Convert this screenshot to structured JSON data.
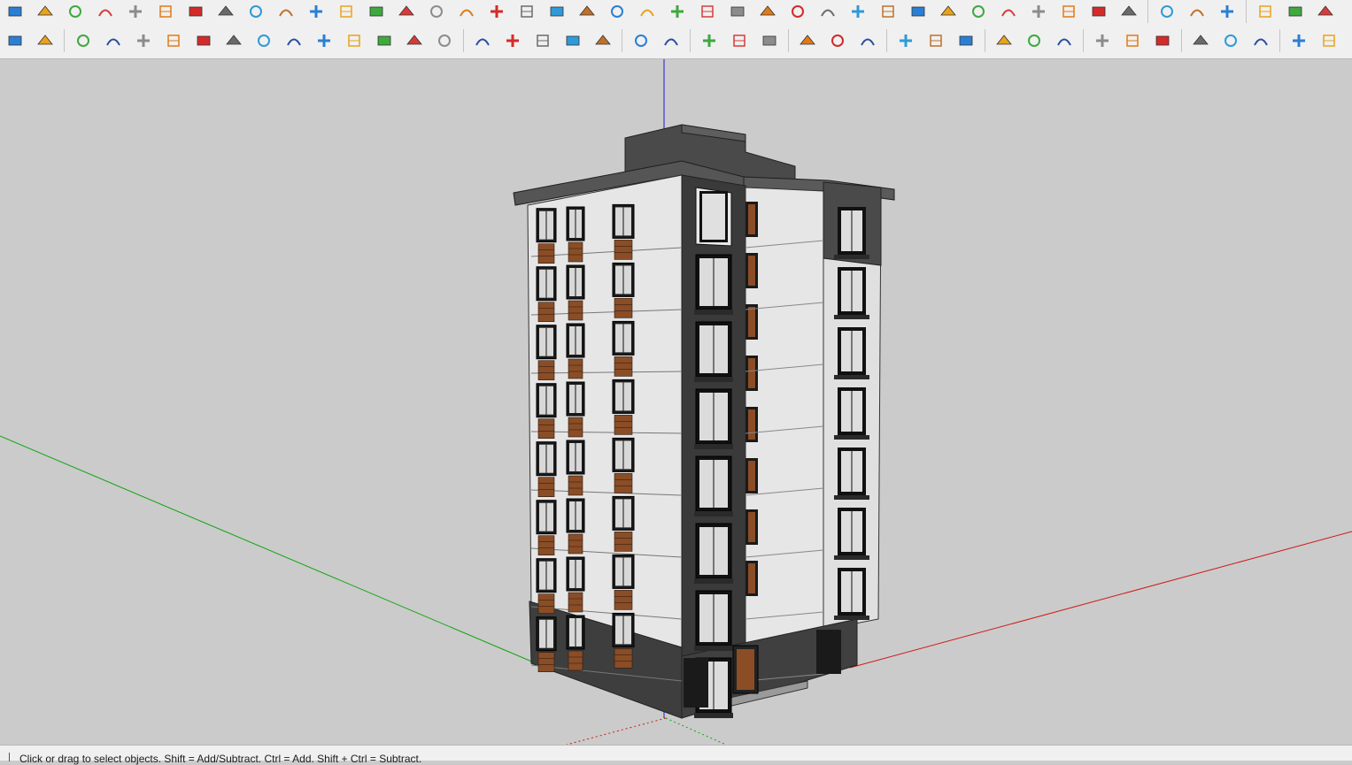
{
  "status_bar": {
    "hint": "Click or drag to select objects. Shift = Add/Subtract. Ctrl = Add. Shift + Ctrl = Subtract."
  },
  "toolbar_top": [
    "box-section-icon",
    "sandbox-yellow-icon",
    "sandbox-green-icon",
    "sandbox-red-icon",
    "grid-plane-icon",
    "undo-orange-icon",
    "red-block-icon",
    "table-icon",
    "flag-icon",
    "chair-icon",
    "pipe-icon",
    "curve-icon",
    "node-red-icon",
    "red-cross-icon",
    "green-cross-icon",
    "blue-cross-icon",
    "cone-blue-icon",
    "cone-green-icon",
    "warning-icon",
    "rotate-orange-icon",
    "rotate-red-icon",
    "rotate-blue-icon",
    "move-arrows-icon",
    "bucket-icon",
    "loop-red-icon",
    "green-arrow-icon",
    "export-icon",
    "rotate-copy-icon",
    "shape-copy-icon",
    "red-gem-icon",
    "scatter-icon",
    "plane-icon",
    "grid-orange-icon",
    "grid-yellow-icon",
    "grid-yellow-2-icon",
    "points-icon",
    "curve-points-icon",
    "matrix-icon",
    "pencil-icon",
    "dimension-icon",
    "cursor-blue-icon",
    "paint-icon",
    "brush-blue-icon",
    "arrow-icon"
  ],
  "toolbar_bottom": [
    "bezier-red-icon",
    "green-polyhedron-icon",
    "arc-curve-icon",
    "polyline-icon",
    "zigzag-icon",
    "n-curve-icon",
    "s-curve-icon",
    "green-arc-icon",
    "rectangle-icon",
    "spiral-icon",
    "arc-icon",
    "green-spline-icon",
    "hook-icon",
    "semi-arc-icon",
    "red-arc-icon",
    "line-icon",
    "polygon-icon",
    "wrench-icon",
    "ellipse-icon",
    "sector-icon",
    "layers-icon",
    "stack-icon",
    "select-cursor-icon",
    "scale-up-icon",
    "scale-down-icon",
    "align-left-icon",
    "align-add-icon",
    "align-remove-icon",
    "dash-line-icon",
    "dash-add-icon",
    "dash-remove-icon",
    "frame-x-icon",
    "frame-grid-icon",
    "frame-red-icon",
    "table-grid-icon",
    "table-blue-icon",
    "frame-select-icon",
    "brick-icon",
    "texture-icon",
    "cloud-icon",
    "checker-icon",
    "expand-icon"
  ],
  "colors": {
    "viewport_bg": "#cbcbcb",
    "toolbar_bg": "#f0f0f0",
    "axis_blue": "#1a1acc",
    "axis_green": "#11a611",
    "axis_red": "#d01818",
    "facade_white": "#e6e6e6",
    "facade_gray": "#3e3e3e",
    "wood_accent": "#8a4d26"
  }
}
